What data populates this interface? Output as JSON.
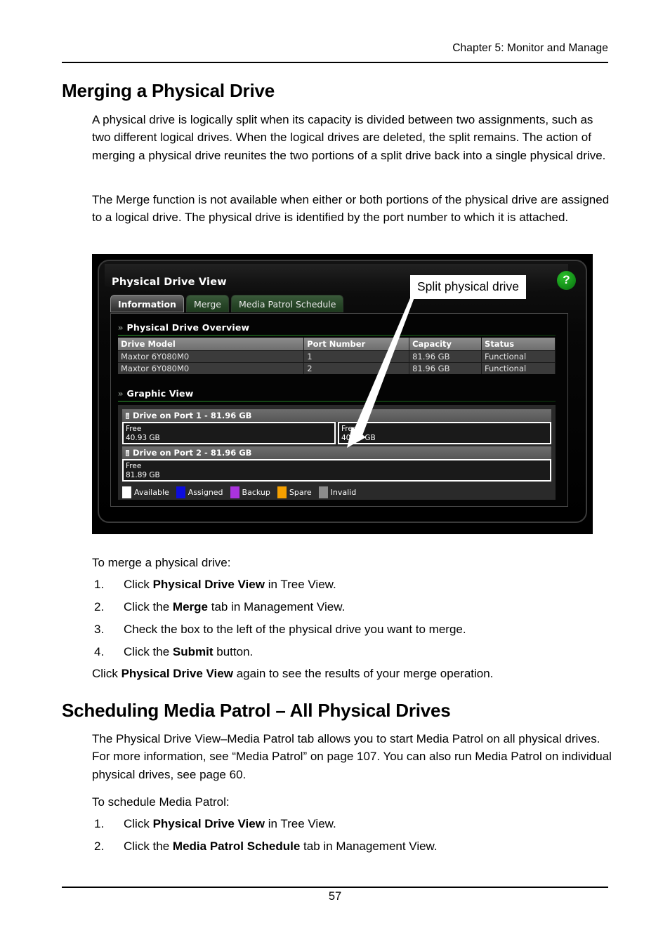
{
  "page": {
    "running_head": "Chapter 5: Monitor and Manage",
    "folio": "57"
  },
  "section_1": {
    "heading": "Merging a Physical Drive",
    "paragraph_1": "A physical drive is logically split when its capacity is divided between two assignments, such as two different logical drives. When the logical drives are deleted, the split remains. The action of merging a physical drive reunites the two portions of a split drive back into a single physical drive.",
    "paragraph_2": "The Merge function is not available when either or both portions of the physical drive are assigned to a logical drive. The physical drive is identified by the port number to which it is attached.",
    "lead_in": "To merge a physical drive:",
    "steps": [
      {
        "num": "1.",
        "text": "Click Physical Drive View in Tree View.",
        "pre": "Click ",
        "bold": "Physical Drive View",
        "post": " in Tree View."
      },
      {
        "num": "2.",
        "text": "Click the Merge tab in Management View.",
        "pre": "Click the ",
        "bold": "Merge",
        "post": " tab in Management View."
      },
      {
        "num": "3.",
        "text": "Check the box to the left of the physical drive you want to merge.",
        "pre": "Check the box to the left of the physical drive you want to merge.",
        "bold": "",
        "post": ""
      },
      {
        "num": "4.",
        "text": "Click the Submit button.",
        "pre": "Click the ",
        "bold": "Submit",
        "post": " button."
      }
    ],
    "closing_pre": "Click ",
    "closing_bold": "Physical Drive View",
    "closing_post": " again to see the results of your merge operation."
  },
  "section_2": {
    "heading": "Scheduling Media Patrol – All Physical Drives",
    "paragraph_1": "The Physical Drive View–Media Patrol tab allows you to start Media Patrol on all physical drives. For more information, see “Media Patrol” on page 107. You can also run Media Patrol on individual physical drives, see page 60.",
    "lead_in": "To schedule Media Patrol:",
    "steps": [
      {
        "num": "1.",
        "pre": "Click ",
        "bold": "Physical Drive View",
        "post": " in Tree View."
      },
      {
        "num": "2.",
        "pre": "Click the ",
        "bold": "Media Patrol Schedule",
        "post": " tab in Management View."
      }
    ]
  },
  "screenshot": {
    "app_title": "Physical Drive View",
    "help_icon_label": "?",
    "tabs": [
      {
        "label": "Information",
        "active": true
      },
      {
        "label": "Merge",
        "active": false
      },
      {
        "label": "Media Patrol Schedule",
        "active": false
      }
    ],
    "overview_section_title": "Physical Drive Overview",
    "graphic_section_title": "Graphic View",
    "table": {
      "headers": [
        "Drive Model",
        "Port Number",
        "Capacity",
        "Status"
      ],
      "rows": [
        [
          "Maxtor 6Y080M0",
          "1",
          "81.96 GB",
          "Functional"
        ],
        [
          "Maxtor 6Y080M0",
          "2",
          "81.96 GB",
          "Functional"
        ]
      ]
    },
    "drives": [
      {
        "header": "Drive on Port 1 - 81.96 GB",
        "segments": [
          {
            "label": "Free",
            "size": "40.93 GB"
          },
          {
            "label": "Free",
            "size": "40.93 GB"
          }
        ]
      },
      {
        "header": "Drive on Port 2 - 81.96 GB",
        "segments": [
          {
            "label": "Free",
            "size": "81.89 GB"
          }
        ]
      }
    ],
    "legend": [
      {
        "label": "Available",
        "color": "#ffffff"
      },
      {
        "label": "Assigned",
        "color": "#0d0ddd"
      },
      {
        "label": "Backup",
        "color": "#aa33dd"
      },
      {
        "label": "Spare",
        "color": "#f5a000"
      },
      {
        "label": "Invalid",
        "color": "#8c8c8c"
      }
    ],
    "callout": "Split physical drive"
  }
}
